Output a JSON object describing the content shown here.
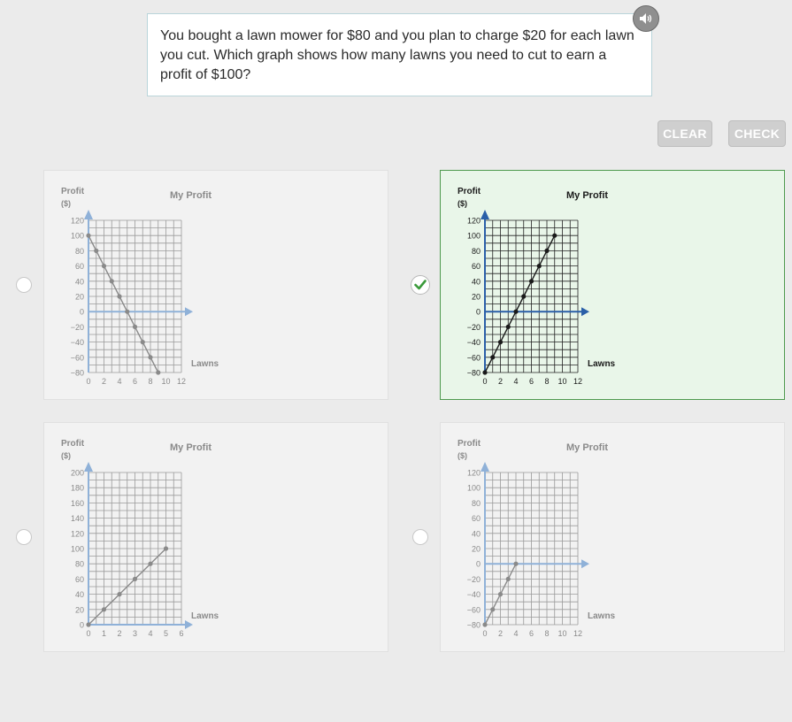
{
  "question": {
    "text": "You bought a lawn mower for $80 and you plan to charge $20 for each lawn you cut. Which graph shows how many lawns you need to cut to earn a profit of $100?",
    "audio_icon": "speaker-icon"
  },
  "buttons": {
    "clear": "CLEAR",
    "check": "CHECK"
  },
  "colors": {
    "selected_border": "#4e9a4e",
    "selected_bg": "#e9f6e9",
    "check_mark": "#3a9a3a"
  },
  "options": [
    {
      "id": "option-a",
      "selected": false
    },
    {
      "id": "option-b",
      "selected": true
    },
    {
      "id": "option-c",
      "selected": false
    },
    {
      "id": "option-d",
      "selected": false
    }
  ],
  "chart_data": [
    {
      "type": "line",
      "title": "My Profit",
      "ylabel": [
        "Profit",
        "($)"
      ],
      "xlabel": "Lawns",
      "xlim": [
        0,
        12
      ],
      "ylim": [
        -80,
        120
      ],
      "x_ticks": [
        0,
        2,
        4,
        6,
        8,
        10,
        12
      ],
      "y_ticks": [
        120,
        100,
        80,
        60,
        40,
        20,
        0,
        -20,
        -40,
        -60,
        -80
      ],
      "x": [
        0,
        1,
        2,
        3,
        4,
        5,
        6,
        7,
        8,
        9
      ],
      "y": [
        100,
        80,
        60,
        40,
        20,
        0,
        -20,
        -40,
        -60,
        -80
      ]
    },
    {
      "type": "line",
      "title": "My Profit",
      "ylabel": [
        "Profit",
        "($)"
      ],
      "xlabel": "Lawns",
      "xlim": [
        0,
        12
      ],
      "ylim": [
        -80,
        120
      ],
      "x_ticks": [
        0,
        2,
        4,
        6,
        8,
        10,
        12
      ],
      "y_ticks": [
        120,
        100,
        80,
        60,
        40,
        20,
        0,
        -20,
        -40,
        -60,
        -80
      ],
      "x": [
        0,
        1,
        2,
        3,
        4,
        5,
        6,
        7,
        8,
        9
      ],
      "y": [
        -80,
        -60,
        -40,
        -20,
        0,
        20,
        40,
        60,
        80,
        100
      ]
    },
    {
      "type": "line",
      "title": "My Profit",
      "ylabel": [
        "Profit",
        "($)"
      ],
      "xlabel": "Lawns",
      "xlim": [
        0,
        6
      ],
      "ylim": [
        0,
        200
      ],
      "x_ticks": [
        0,
        1,
        2,
        3,
        4,
        5,
        6
      ],
      "y_ticks": [
        200,
        180,
        160,
        140,
        120,
        100,
        80,
        60,
        40,
        20,
        0
      ],
      "x": [
        0,
        1,
        2,
        3,
        4,
        5
      ],
      "y": [
        0,
        20,
        40,
        60,
        80,
        100
      ]
    },
    {
      "type": "line",
      "title": "My Profit",
      "ylabel": [
        "Profit",
        "($)"
      ],
      "xlabel": "Lawns",
      "xlim": [
        0,
        12
      ],
      "ylim": [
        -80,
        120
      ],
      "x_ticks": [
        0,
        2,
        4,
        6,
        8,
        10,
        12
      ],
      "y_ticks": [
        120,
        100,
        80,
        60,
        40,
        20,
        0,
        -20,
        -40,
        -60,
        -80
      ],
      "x": [
        0,
        1,
        2,
        3,
        4
      ],
      "y": [
        -80,
        -60,
        -40,
        -20,
        0
      ]
    }
  ]
}
